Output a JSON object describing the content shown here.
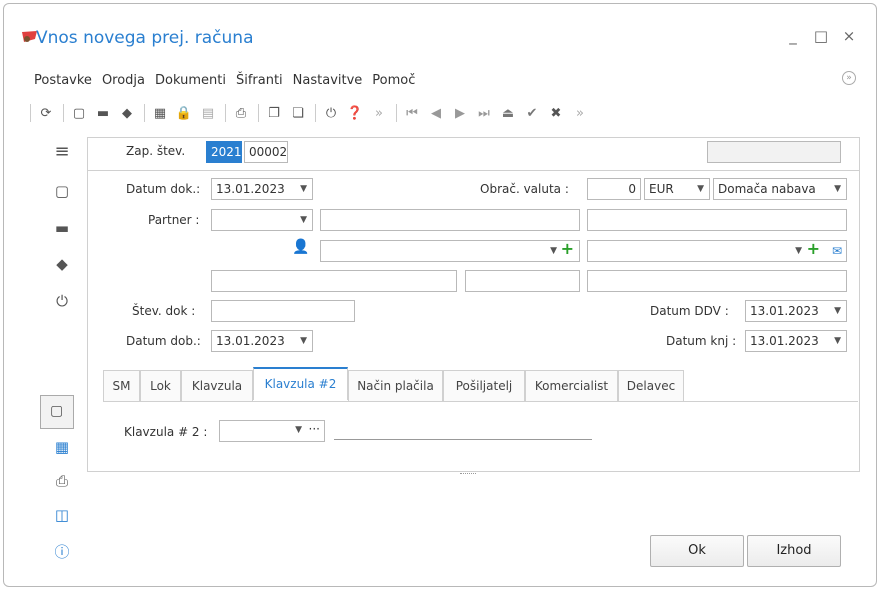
{
  "window": {
    "title": "Vnos novega prej. računa",
    "min_label": "_",
    "max_label": "□",
    "close_label": "×"
  },
  "menu": [
    "Postavke",
    "Orodja",
    "Dokumenti",
    "Šifranti",
    "Nastavitve",
    "Pomoč"
  ],
  "header": {
    "zap_label": "Zap. štev.",
    "year": "2021",
    "number": "00002"
  },
  "form": {
    "datum_dok_label": "Datum dok.:",
    "datum_dok": "13.01.2023",
    "valuta_label": "Obrač. valuta :",
    "valuta_amount": "0",
    "currency": "EUR",
    "nabava": "Domača nabava",
    "partner_label": "Partner :",
    "stev_dok_label": "Štev. dok :",
    "datum_ddv_label": "Datum DDV :",
    "datum_ddv": "13.01.2023",
    "datum_dob_label": "Datum dob.:",
    "datum_dob": "13.01.2023",
    "datum_knj_label": "Datum knj :",
    "datum_knj": "13.01.2023"
  },
  "tabs": [
    "SM",
    "Lok",
    "Klavzula",
    "Klavzula #2",
    "Način plačila",
    "Pošiljatelj",
    "Komercialist",
    "Delavec"
  ],
  "active_tab": "Klavzula #2",
  "klavzula": {
    "label": "Klavzula # 2 :",
    "more": "···"
  },
  "buttons": {
    "ok": "Ok",
    "exit": "Izhod"
  },
  "colors": {
    "accent": "#2a7fd0",
    "green": "#2aa02a"
  }
}
